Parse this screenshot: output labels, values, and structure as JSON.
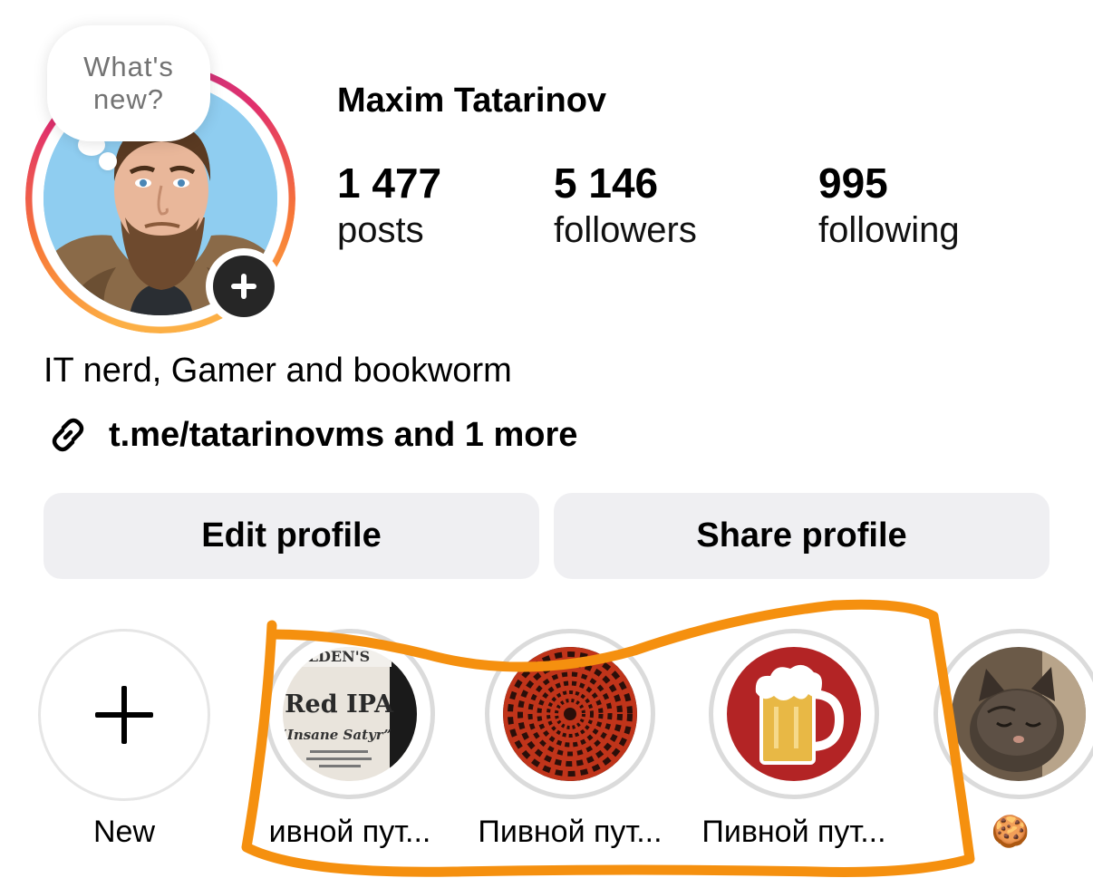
{
  "profile": {
    "name": "Maxim Tatarinov",
    "note": "What's new?",
    "bio": "IT nerd, Gamer and bookworm",
    "link": "t.me/tatarinovms and 1 more"
  },
  "stats": [
    {
      "value": "1 477",
      "label": "posts"
    },
    {
      "value": "5 146",
      "label": "followers"
    },
    {
      "value": "995",
      "label": "following"
    }
  ],
  "buttons": {
    "edit": "Edit profile",
    "share": "Share profile"
  },
  "highlights": [
    {
      "label": "New",
      "icon": "plus-icon"
    },
    {
      "label": "Пивной пут...",
      "thumb": "beer-label-photo",
      "display": "ивной пут..."
    },
    {
      "label": "Пивной пут...",
      "thumb": "red-spiral-pattern"
    },
    {
      "label": "Пивной пут...",
      "thumb": "beer-mug-icon"
    },
    {
      "label": "🍪",
      "thumb": "cat-photo"
    }
  ],
  "colors": {
    "story_ring": [
      "#fcaf45",
      "#f77737",
      "#e1306c",
      "#c13584"
    ],
    "button_bg": "#efeff2",
    "annotation": "#f5900f"
  }
}
